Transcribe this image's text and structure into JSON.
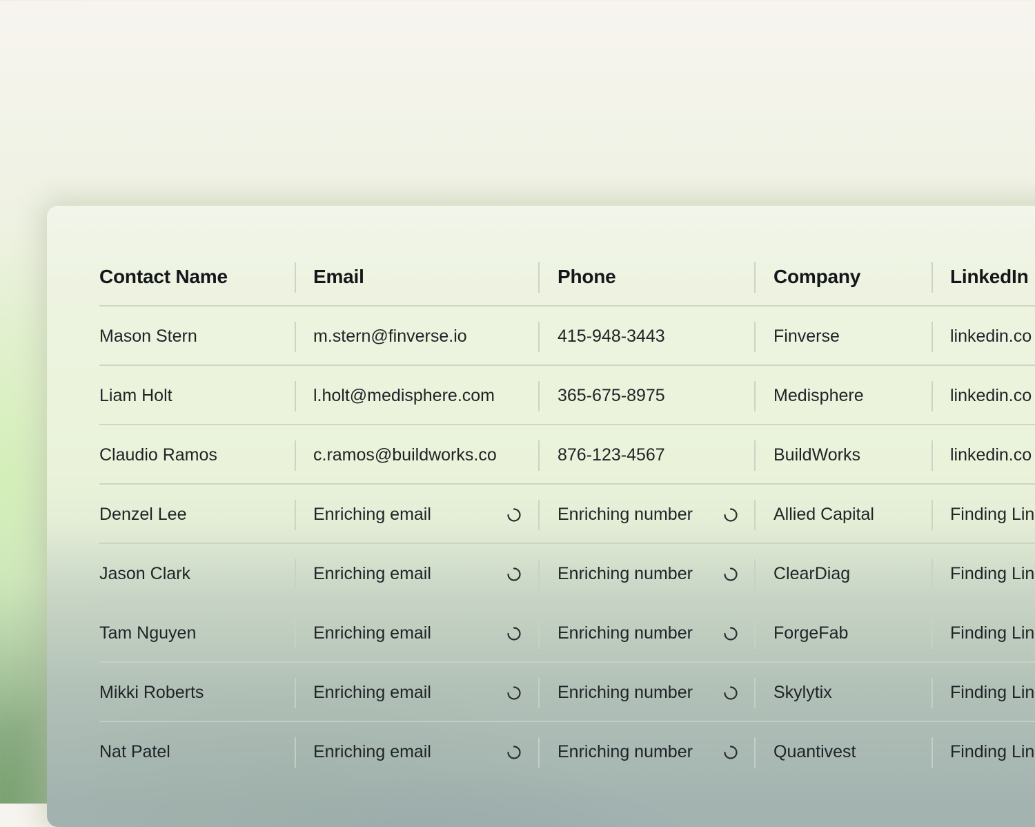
{
  "table": {
    "headers": [
      "Contact Name",
      "Email",
      "Phone",
      "Company",
      "LinkedIn"
    ],
    "rows": [
      {
        "name": "Mason Stern",
        "email": "m.stern@finverse.io",
        "phone": "415-948-3443",
        "company": "Finverse",
        "linkedin": "linkedin.co",
        "enriching": false
      },
      {
        "name": "Liam Holt",
        "email": "l.holt@medisphere.com",
        "phone": "365-675-8975",
        "company": "Medisphere",
        "linkedin": "linkedin.co",
        "enriching": false
      },
      {
        "name": "Claudio Ramos",
        "email": "c.ramos@buildworks.co",
        "phone": "876-123-4567",
        "company": "BuildWorks",
        "linkedin": "linkedin.co",
        "enriching": false
      },
      {
        "name": "Denzel Lee",
        "email": "Enriching email",
        "phone": "Enriching number",
        "company": "Allied Capital",
        "linkedin": "Finding Lin",
        "enriching": true
      },
      {
        "name": "Jason Clark",
        "email": "Enriching email",
        "phone": "Enriching number",
        "company": "ClearDiag",
        "linkedin": "Finding Lin",
        "enriching": true
      },
      {
        "name": "Tam Nguyen",
        "email": "Enriching email",
        "phone": "Enriching number",
        "company": "ForgeFab",
        "linkedin": "Finding Lin",
        "enriching": true
      },
      {
        "name": "Mikki Roberts",
        "email": "Enriching email",
        "phone": "Enriching number",
        "company": "Skylytix",
        "linkedin": "Finding Lin",
        "enriching": true
      },
      {
        "name": "Nat Patel",
        "email": "Enriching email",
        "phone": "Enriching number",
        "company": "Quantivest",
        "linkedin": "Finding Lin",
        "enriching": true
      }
    ]
  },
  "icons": {
    "loading": "loading-spinner-icon"
  },
  "colors": {
    "text": "#1f2326",
    "header_text": "#14171a",
    "divider": "#c8d0c3"
  }
}
